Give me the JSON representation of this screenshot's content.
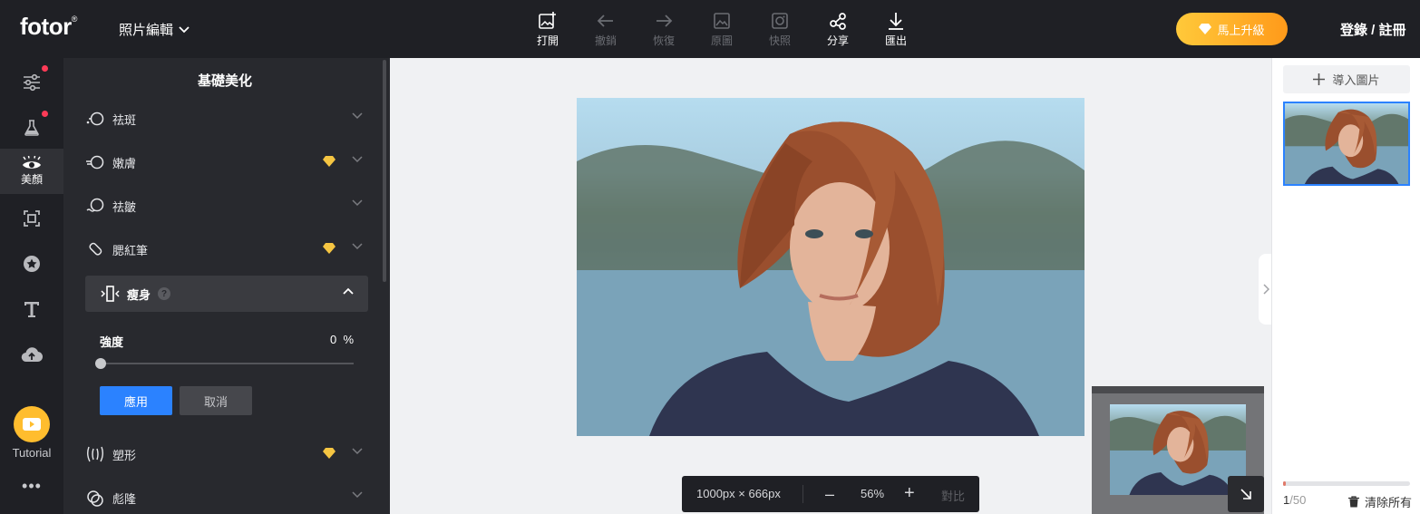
{
  "header": {
    "logo": "fotor",
    "logo_reg": "®",
    "menu_title": "照片編輯",
    "tools": [
      {
        "label": "打開",
        "icon": "open-image-icon",
        "enabled": true
      },
      {
        "label": "撤銷",
        "icon": "undo-arrow-icon",
        "enabled": false
      },
      {
        "label": "恢復",
        "icon": "redo-arrow-icon",
        "enabled": false
      },
      {
        "label": "原圖",
        "icon": "original-image-icon",
        "enabled": false
      },
      {
        "label": "快照",
        "icon": "snapshot-icon",
        "enabled": false
      },
      {
        "label": "分享",
        "icon": "share-icon",
        "enabled": true
      },
      {
        "label": "匯出",
        "icon": "download-icon",
        "enabled": true
      }
    ],
    "upgrade_label": "馬上升級",
    "login_label": "登錄 / 註冊"
  },
  "rail": {
    "items": [
      {
        "icon": "adjust-sliders-icon",
        "label": "",
        "dot": true
      },
      {
        "icon": "flask-icon",
        "label": "",
        "dot": true
      },
      {
        "icon": "eye-icon",
        "label": "美顏",
        "active": true
      },
      {
        "icon": "frame-icon",
        "label": ""
      },
      {
        "icon": "star-badge-icon",
        "label": ""
      },
      {
        "icon": "text-icon",
        "label": ""
      },
      {
        "icon": "cloud-upload-icon",
        "label": ""
      }
    ],
    "tutorial_label": "Tutorial",
    "more": "•••"
  },
  "panel": {
    "title": "基礎美化",
    "items": [
      {
        "label": "祛斑",
        "premium": false
      },
      {
        "label": "嫩膚",
        "premium": true
      },
      {
        "label": "祛皺",
        "premium": false
      },
      {
        "label": "腮紅筆",
        "premium": true
      }
    ],
    "expanded": {
      "label": "瘦身",
      "help": "?",
      "strength_label": "強度",
      "strength_value": "0",
      "strength_unit": "%",
      "strength": 0,
      "apply_label": "應用",
      "cancel_label": "取消"
    },
    "items_after": [
      {
        "label": "塑形",
        "premium": true
      },
      {
        "label": "彪隆",
        "premium": false
      }
    ]
  },
  "canvas": {
    "dimensions": "1000px × 666px",
    "zoom": "56%",
    "minus": "–",
    "plus": "+",
    "compare_label": "對比"
  },
  "right_panel": {
    "import_label": "導入圖片",
    "count_current": "1",
    "count_total": "/50",
    "progress": 0.02,
    "clear_label": "清除所有"
  },
  "colors": {
    "accent_blue": "#2b82ff",
    "upgrade_gradient_start": "#ffc93a",
    "upgrade_gradient_end": "#ff9a1a",
    "premium_gem": "#f5c542",
    "notify_dot": "#ff3b57"
  }
}
